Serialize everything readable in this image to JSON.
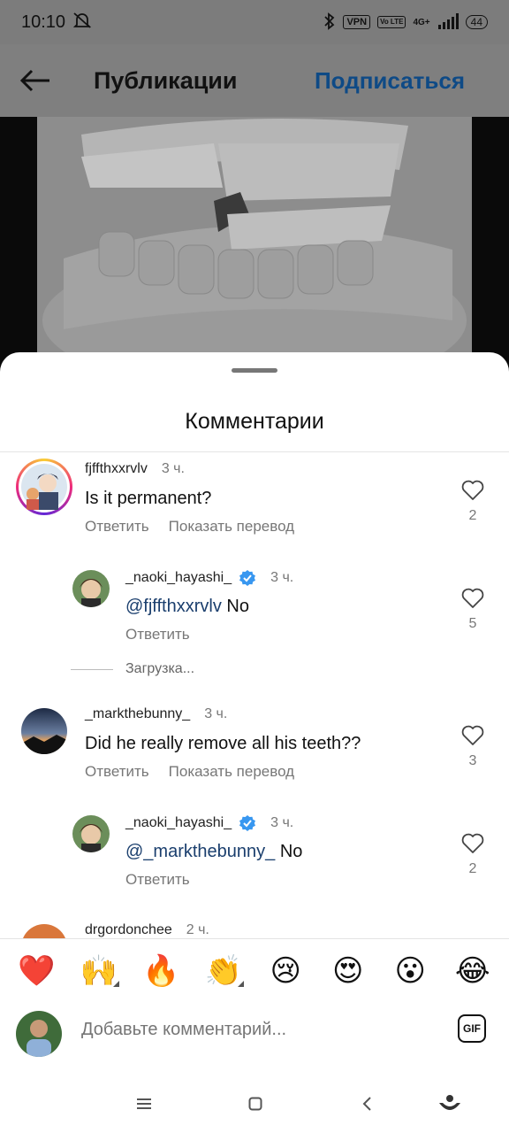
{
  "status_bar": {
    "time": "10:10",
    "vpn": "VPN",
    "volte": "Vo LTE",
    "network": "4G+",
    "battery": "44"
  },
  "header": {
    "title": "Публикации",
    "follow_label": "Подписаться"
  },
  "sheet": {
    "title": "Комментарии"
  },
  "comments": [
    {
      "username": "fjffthxxrvlv",
      "time": "3 ч.",
      "text": "Is it permanent?",
      "reply_label": "Ответить",
      "translate_label": "Показать перевод",
      "likes": "2"
    },
    {
      "username": "_naoki_hayashi_",
      "verified": true,
      "time": "3 ч.",
      "mention": "@fjffthxxrvlv",
      "text": "No",
      "reply_label": "Ответить",
      "likes": "5"
    },
    {
      "username": "_markthebunny_",
      "time": "3 ч.",
      "text": "Did he really remove all his teeth??",
      "reply_label": "Ответить",
      "translate_label": "Показать перевод",
      "likes": "3"
    },
    {
      "username": "_naoki_hayashi_",
      "verified": true,
      "time": "3 ч.",
      "mention": "@_markthebunny_",
      "text": "No",
      "reply_label": "Ответить",
      "likes": "2"
    },
    {
      "username": "drgordonchee",
      "time": "2 ч."
    }
  ],
  "loading_label": "Загрузка...",
  "emojis": [
    "❤️",
    "🙌",
    "🔥",
    "👏",
    "😢",
    "😍",
    "😮",
    "😂"
  ],
  "composer": {
    "placeholder": "Добавьте комментарий...",
    "gif_label": "GIF"
  },
  "colors": {
    "mention": "#1a3e6d",
    "follow": "#0e4a86",
    "verified": "#3897f0"
  }
}
